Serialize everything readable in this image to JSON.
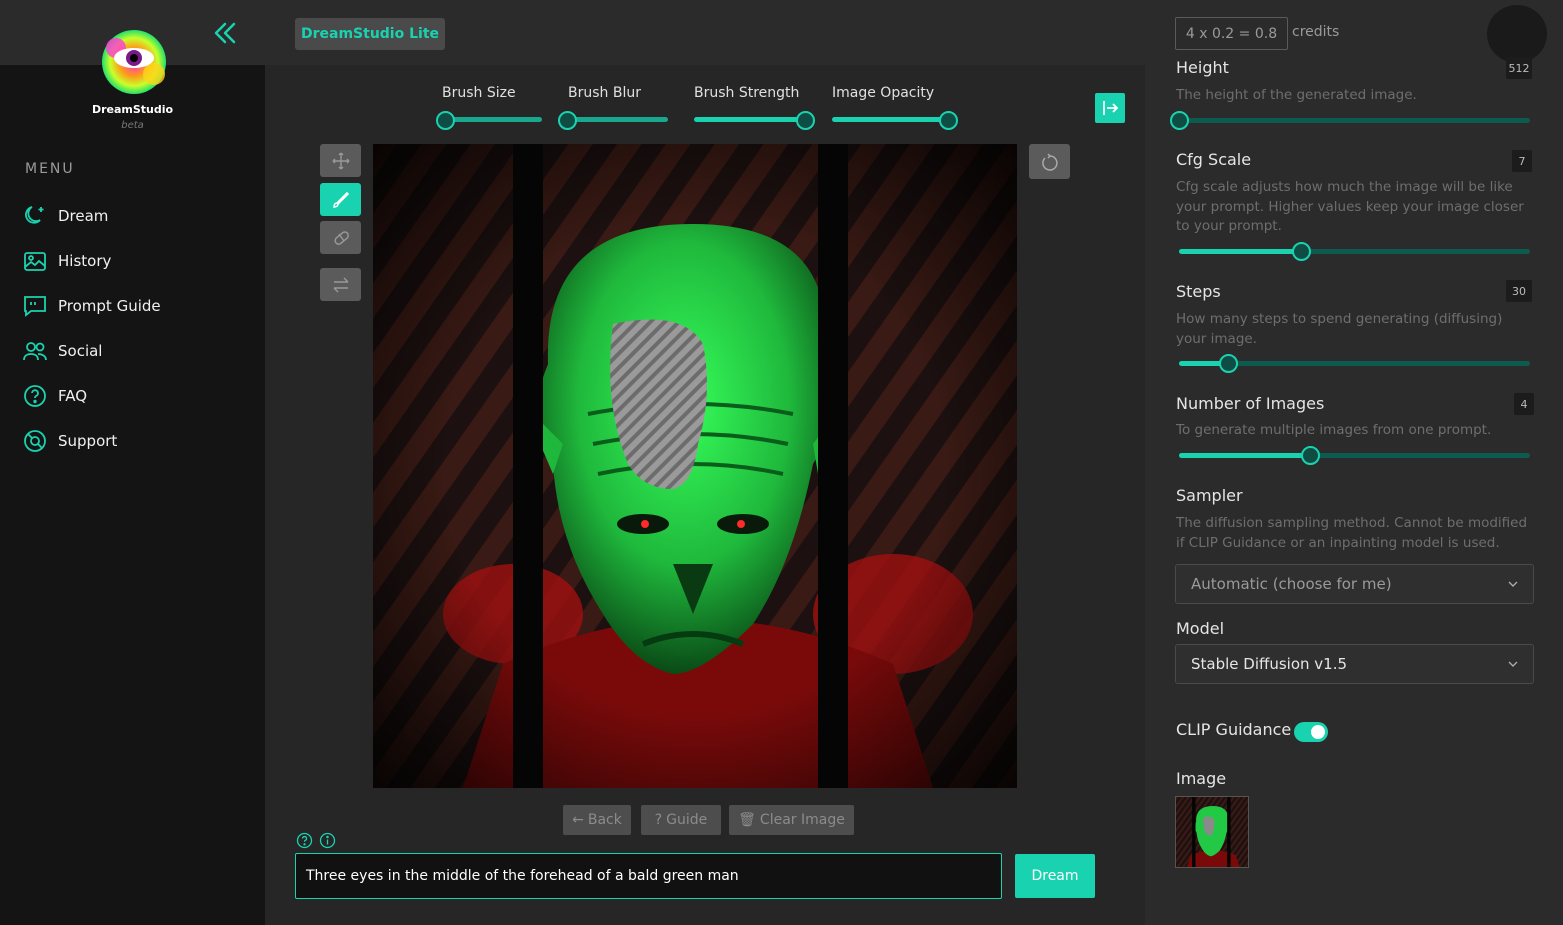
{
  "app": {
    "brand": "DreamStudio",
    "brand_sub": "beta",
    "tab_label": "DreamStudio Lite"
  },
  "sidebar": {
    "menu_title": "MENU",
    "items": [
      {
        "label": "Dream",
        "icon": "moon-sparkle-icon"
      },
      {
        "label": "History",
        "icon": "image-gallery-icon"
      },
      {
        "label": "Prompt Guide",
        "icon": "quote-bubble-icon"
      },
      {
        "label": "Social",
        "icon": "users-icon"
      },
      {
        "label": "FAQ",
        "icon": "question-circle-icon"
      },
      {
        "label": "Support",
        "icon": "support-icon"
      }
    ]
  },
  "credits": {
    "formula": "4 x 0.2 = 0.8",
    "label": "credits"
  },
  "brush": {
    "size_label": "Brush Size",
    "size_value": 0.0,
    "blur_label": "Brush Blur",
    "blur_value": 0.0,
    "strength_label": "Brush Strength",
    "strength_value": 1.0,
    "opacity_label": "Image Opacity",
    "opacity_value": 1.0
  },
  "tools": [
    "move-tool",
    "brush-tool",
    "eraser-tool",
    "swap-tool"
  ],
  "canvas_buttons": {
    "back": "Back",
    "guide": "Guide",
    "clear": "Clear Image"
  },
  "prompt": {
    "value": "Three eyes in the middle of the forehead of a bald green man",
    "dream_label": "Dream"
  },
  "settings": {
    "height": {
      "title": "Height",
      "value": "512",
      "desc": "The height of the generated image.",
      "fraction": 0.0
    },
    "cfg": {
      "title": "Cfg Scale",
      "value": "7",
      "desc": "Cfg scale adjusts how much the image will be like your prompt. Higher values keep your image closer to your prompt.",
      "fraction": 0.35
    },
    "steps": {
      "title": "Steps",
      "value": "30",
      "desc": "How many steps to spend generating (diffusing) your image.",
      "fraction": 0.143
    },
    "images": {
      "title": "Number of Images",
      "value": "4",
      "desc": "To generate multiple images from one prompt.",
      "fraction": 0.375
    },
    "sampler": {
      "title": "Sampler",
      "desc": "The diffusion sampling method. Cannot be modified if CLIP Guidance or an inpainting model is used.",
      "selected": "Automatic (choose for me)"
    },
    "model": {
      "title": "Model",
      "selected": "Stable Diffusion v1.5"
    },
    "clip": {
      "title": "CLIP Guidance",
      "enabled": true
    },
    "image": {
      "title": "Image"
    }
  },
  "colors": {
    "accent": "#19d3b0",
    "bg": "#2b2b2b",
    "sidebar": "#141414"
  }
}
